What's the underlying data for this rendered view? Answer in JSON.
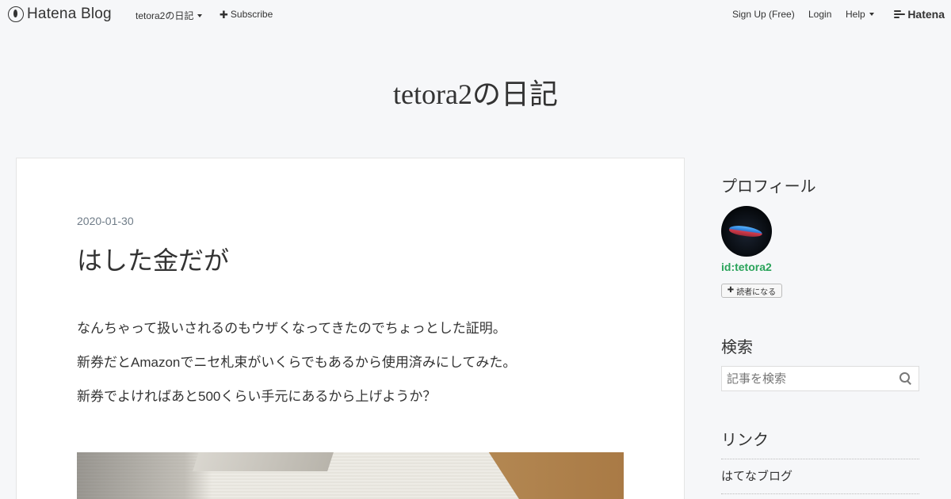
{
  "topbar": {
    "logo_text": "Hatena Blog",
    "blog_menu_label": "tetora2の日記",
    "subscribe_label": "Subscribe",
    "signup_label": "Sign Up (Free)",
    "login_label": "Login",
    "help_label": "Help",
    "brand_label": "Hatena"
  },
  "blog": {
    "title": "tetora2の日記"
  },
  "entry": {
    "date": "2020-01-30",
    "title": "はした金だが",
    "paragraphs": [
      "なんちゃって扱いされるのもウザくなってきたのでちょっとした証明。",
      "新券だとAmazonでニセ札束がいくらでもあるから使用済みにしてみた。",
      "新券でよければあと500くらい手元にあるから上げようか？"
    ]
  },
  "sidebar": {
    "profile": {
      "heading": "プロフィール",
      "user_id": "id:tetora2",
      "reader_button_label": "読者になる"
    },
    "search": {
      "heading": "検索",
      "placeholder": "記事を検索"
    },
    "links": {
      "heading": "リンク",
      "items": [
        "はてなブログ"
      ]
    }
  },
  "icons": {
    "logo": "hatena-blog-logo-icon",
    "subscribe": "plus-icon",
    "search": "magnifier-icon",
    "reader": "plus-icon"
  },
  "colors": {
    "background": "#f6f7f9",
    "accent_green": "#2aa35a",
    "date_gray": "#6f7c88"
  }
}
